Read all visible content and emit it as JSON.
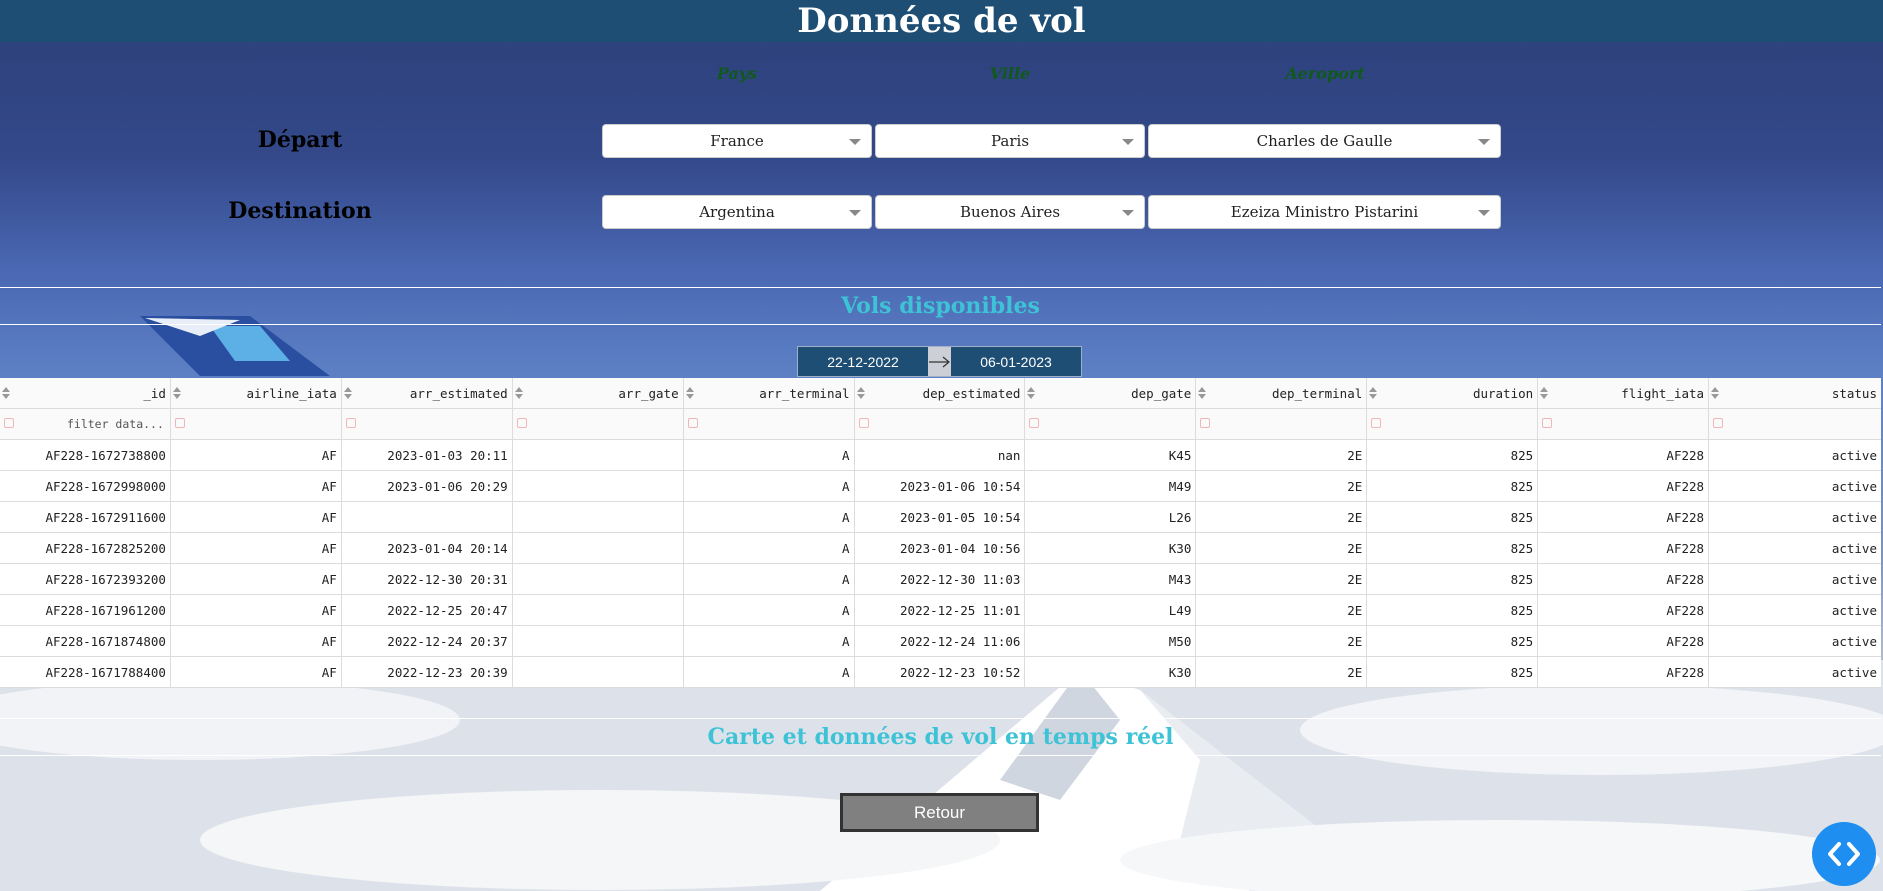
{
  "header": {
    "title": "Données de vol"
  },
  "column_labels": [
    "Pays",
    "Ville",
    "Aeroport"
  ],
  "departure": {
    "label": "Départ",
    "country": "France",
    "city": "Paris",
    "airport": "Charles de Gaulle"
  },
  "destination": {
    "label": "Destination",
    "country": "Argentina",
    "city": "Buenos Aires",
    "airport": "Ezeiza Ministro Pistarini"
  },
  "flights_section": {
    "title": "Vols disponibles"
  },
  "date_range": {
    "start": "22-12-2022",
    "end": "06-01-2023"
  },
  "table": {
    "columns": [
      "_id",
      "airline_iata",
      "arr_estimated",
      "arr_gate",
      "arr_terminal",
      "dep_estimated",
      "dep_gate",
      "dep_terminal",
      "duration",
      "flight_iata",
      "status"
    ],
    "filter_placeholder": "filter data...",
    "rows": [
      [
        "AF228-1672738800",
        "AF",
        "2023-01-03 20:11",
        "",
        "A",
        "nan",
        "K45",
        "2E",
        "825",
        "AF228",
        "active"
      ],
      [
        "AF228-1672998000",
        "AF",
        "2023-01-06 20:29",
        "",
        "A",
        "2023-01-06 10:54",
        "M49",
        "2E",
        "825",
        "AF228",
        "active"
      ],
      [
        "AF228-1672911600",
        "AF",
        "",
        "",
        "A",
        "2023-01-05 10:54",
        "L26",
        "2E",
        "825",
        "AF228",
        "active"
      ],
      [
        "AF228-1672825200",
        "AF",
        "2023-01-04 20:14",
        "",
        "A",
        "2023-01-04 10:56",
        "K30",
        "2E",
        "825",
        "AF228",
        "active"
      ],
      [
        "AF228-1672393200",
        "AF",
        "2022-12-30 20:31",
        "",
        "A",
        "2022-12-30 11:03",
        "M43",
        "2E",
        "825",
        "AF228",
        "active"
      ],
      [
        "AF228-1671961200",
        "AF",
        "2022-12-25 20:47",
        "",
        "A",
        "2022-12-25 11:01",
        "L49",
        "2E",
        "825",
        "AF228",
        "active"
      ],
      [
        "AF228-1671874800",
        "AF",
        "2022-12-24 20:37",
        "",
        "A",
        "2022-12-24 11:06",
        "M50",
        "2E",
        "825",
        "AF228",
        "active"
      ],
      [
        "AF228-1671788400",
        "AF",
        "2022-12-23 20:39",
        "",
        "A",
        "2022-12-23 10:52",
        "K30",
        "2E",
        "825",
        "AF228",
        "active"
      ]
    ]
  },
  "map_section": {
    "title": "Carte et données de vol en temps réel"
  },
  "retour_button": {
    "label": "Retour"
  },
  "colors": {
    "header_bg": "#1e4e74",
    "section_title": "#3ec3d6",
    "column_label": "#0f5a1a",
    "fab": "#1e8ef0"
  },
  "icons": {
    "dropdown": "caret-down-icon",
    "date_arrow": "arrow-right-icon",
    "sort": "sort-icon",
    "fab": "code-chevrons-icon"
  }
}
